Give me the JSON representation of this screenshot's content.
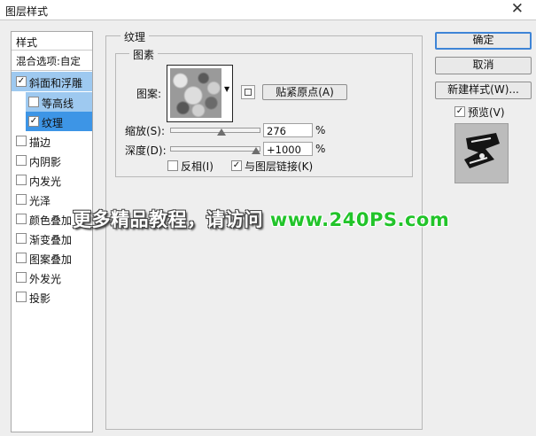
{
  "window": {
    "title": "图层样式",
    "close_icon": "close-icon"
  },
  "styles": {
    "header": "样式",
    "blend_options": "混合选项:自定",
    "items": [
      {
        "label": "斜面和浮雕",
        "checked": true
      },
      {
        "label": "等高线",
        "checked": false
      },
      {
        "label": "纹理",
        "checked": true
      },
      {
        "label": "描边",
        "checked": false
      },
      {
        "label": "内阴影",
        "checked": false
      },
      {
        "label": "内发光",
        "checked": false
      },
      {
        "label": "光泽",
        "checked": false
      },
      {
        "label": "颜色叠加",
        "checked": false
      },
      {
        "label": "渐变叠加",
        "checked": false
      },
      {
        "label": "图案叠加",
        "checked": false
      },
      {
        "label": "外发光",
        "checked": false
      },
      {
        "label": "投影",
        "checked": false
      }
    ]
  },
  "texture": {
    "group_title": "纹理",
    "pattern_group_title": "图素",
    "pattern_label": "图案:",
    "snap_origin_label": "贴紧原点(A)",
    "scale_label": "缩放(S):",
    "scale_value": "276",
    "scale_unit": "%",
    "depth_label": "深度(D):",
    "depth_value": "+1000",
    "depth_unit": "%",
    "invert_label": "反相(I)",
    "invert_checked": false,
    "link_label": "与图层链接(K)",
    "link_checked": true
  },
  "sidebar_buttons": {
    "ok": "确定",
    "cancel": "取消",
    "new_style": "新建样式(W)...",
    "preview_label": "预览(V)",
    "preview_checked": true
  },
  "watermark": {
    "text": "更多精品教程，请访问",
    "url": "www.240PS.com"
  },
  "check_mark": "✓"
}
